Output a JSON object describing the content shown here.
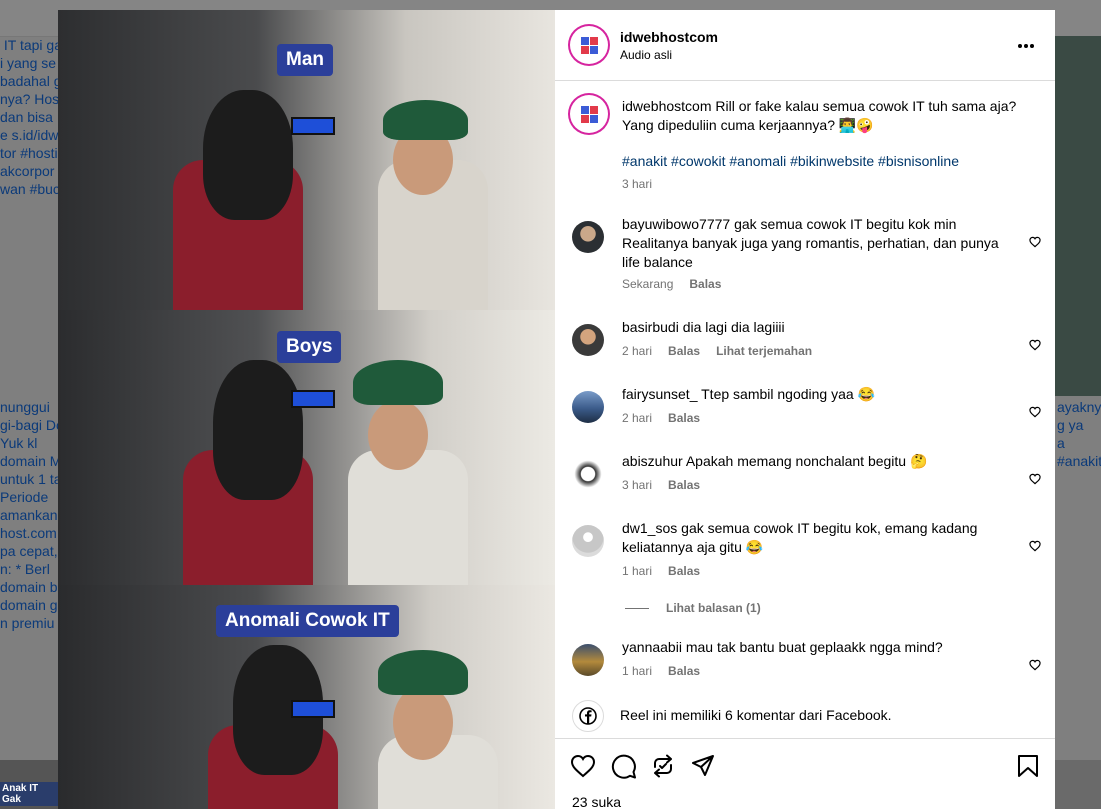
{
  "background": {
    "left_lines": [
      " IT tapi ga",
      "i yang se",
      "badahal g",
      "nya? Hos",
      "dan bisa",
      "e s.id/idw",
      "tor #hosti",
      "akcorpor",
      "wan #buc"
    ],
    "left_lines2": [
      "nunggui",
      "gi-bagi Do",
      "Yuk kl",
      "domain M",
      "untuk 1 ta",
      "Periode",
      "amankan",
      "host.com",
      "pa cepat,",
      "n: * Berl",
      "domain ba",
      "domain g",
      "n premiu"
    ],
    "right_lines": [
      "ayakny",
      "g ya",
      "a",
      "#anakit"
    ],
    "thumb_label": "Anak IT Gak"
  },
  "video": {
    "label_1": "Man",
    "label_2": "Boys",
    "label_3": "Anomali Cowok IT"
  },
  "header": {
    "username": "idwebhostcom",
    "audio": "Audio asli"
  },
  "caption": {
    "username": "idwebhostcom",
    "text": "Rill or fake kalau semua cowok IT tuh sama aja? Yang dipeduliin cuma kerjaannya? 👨‍💻🤪",
    "hashtags": "#anakit #cowokit #anomali #bikinwebsite #bisnisonline",
    "time": "3 hari"
  },
  "comments": [
    {
      "user": "bayuwibowo7777",
      "text": "gak semua cowok IT begitu kok min Realitanya banyak juga yang romantis, perhatian, dan punya life balance",
      "time": "Sekarang",
      "reply": "Balas",
      "extra": ""
    },
    {
      "user": "basirbudi",
      "text": "dia lagi dia lagiiii",
      "time": "2 hari",
      "reply": "Balas",
      "extra": "Lihat terjemahan"
    },
    {
      "user": "fairysunset_",
      "text": "Ttep sambil ngoding yaa 😂",
      "time": "2 hari",
      "reply": "Balas",
      "extra": ""
    },
    {
      "user": "abiszuhur",
      "text": "Apakah memang nonchalant begitu 🤔",
      "time": "3 hari",
      "reply": "Balas",
      "extra": ""
    },
    {
      "user": "dw1_sos",
      "text": "gak semua cowok IT begitu kok, emang kadang keliatannya aja gitu 😂",
      "time": "1 hari",
      "reply": "Balas",
      "extra": ""
    },
    {
      "user": "yannaabii",
      "text": "mau tak bantu buat geplaakk ngga mind?",
      "time": "1 hari",
      "reply": "Balas",
      "extra": ""
    }
  ],
  "view_replies": "Lihat balasan (1)",
  "facebook_note": "Reel ini memiliki 6 komentar dari Facebook.",
  "likes": "23 suka",
  "colors": {
    "link": "#00376b",
    "muted": "#737373",
    "label_bg": "#2b3f9a",
    "ig_gradient": "#d6249f"
  }
}
